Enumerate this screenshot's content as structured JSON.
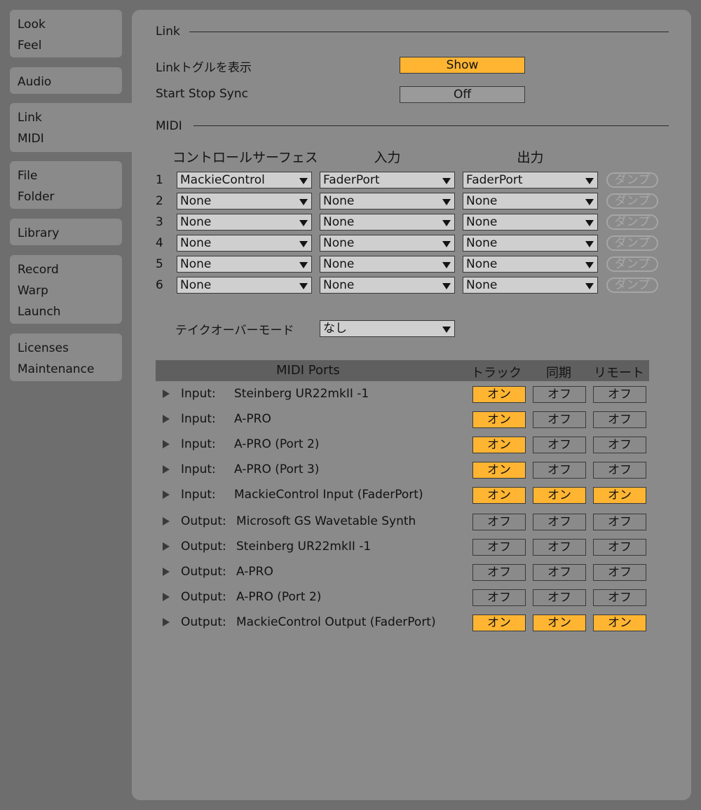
{
  "sidebar": {
    "tabs": [
      {
        "lines": [
          "Look",
          "Feel"
        ]
      },
      {
        "lines": [
          "Audio"
        ]
      },
      {
        "lines": [
          "Link",
          "MIDI"
        ]
      },
      {
        "lines": [
          "File",
          "Folder"
        ]
      },
      {
        "lines": [
          "Library"
        ]
      },
      {
        "lines": [
          "Record",
          "Warp",
          "Launch"
        ]
      },
      {
        "lines": [
          "Licenses",
          "Maintenance"
        ]
      }
    ],
    "active": "Link MIDI"
  },
  "link": {
    "title": "Link",
    "toggle_label": "Linkトグルを表示",
    "toggle_value": "Show",
    "sync_label": "Start Stop Sync",
    "sync_value": "Off"
  },
  "midi": {
    "title": "MIDI",
    "col_surface": "コントロールサーフェス",
    "col_input": "入力",
    "col_output": "出力",
    "dump_label": "ダンプ",
    "surfaces": [
      {
        "index": "1",
        "surface": "MackieControl",
        "input": "FaderPort",
        "output": "FaderPort"
      },
      {
        "index": "2",
        "surface": "None",
        "input": "None",
        "output": "None"
      },
      {
        "index": "3",
        "surface": "None",
        "input": "None",
        "output": "None"
      },
      {
        "index": "4",
        "surface": "None",
        "input": "None",
        "output": "None"
      },
      {
        "index": "5",
        "surface": "None",
        "input": "None",
        "output": "None"
      },
      {
        "index": "6",
        "surface": "None",
        "input": "None",
        "output": "None"
      }
    ],
    "takeover_label": "テイクオーバーモード",
    "takeover_value": "なし"
  },
  "ports": {
    "header": {
      "title": "MIDI Ports",
      "track": "トラック",
      "sync": "同期",
      "remote": "リモート"
    },
    "on_label": "オン",
    "off_label": "オフ",
    "rows": [
      {
        "dir": "Input:",
        "name": "Steinberg UR22mkII -1",
        "track": "オン",
        "sync": "オフ",
        "remote": "オフ"
      },
      {
        "dir": "Input:",
        "name": "A-PRO",
        "track": "オン",
        "sync": "オフ",
        "remote": "オフ"
      },
      {
        "dir": "Input:",
        "name": "A-PRO (Port 2)",
        "track": "オン",
        "sync": "オフ",
        "remote": "オフ"
      },
      {
        "dir": "Input:",
        "name": "A-PRO (Port 3)",
        "track": "オン",
        "sync": "オフ",
        "remote": "オフ"
      },
      {
        "dir": "Input:",
        "name": "MackieControl Input (FaderPort)",
        "track": "オン",
        "sync": "オン",
        "remote": "オン"
      },
      {
        "dir": "Output:",
        "name": "Microsoft GS Wavetable Synth",
        "track": "オフ",
        "sync": "オフ",
        "remote": "オフ"
      },
      {
        "dir": "Output:",
        "name": "Steinberg UR22mkII -1",
        "track": "オフ",
        "sync": "オフ",
        "remote": "オフ"
      },
      {
        "dir": "Output:",
        "name": "A-PRO",
        "track": "オフ",
        "sync": "オフ",
        "remote": "オフ"
      },
      {
        "dir": "Output:",
        "name": "A-PRO (Port 2)",
        "track": "オフ",
        "sync": "オフ",
        "remote": "オフ"
      },
      {
        "dir": "Output:",
        "name": "MackieControl Output (FaderPort)",
        "track": "オン",
        "sync": "オン",
        "remote": "オン"
      }
    ]
  },
  "colors": {
    "accent": "#ffb532",
    "panel": "#8a8a8a",
    "background": "#6e6e6e"
  }
}
